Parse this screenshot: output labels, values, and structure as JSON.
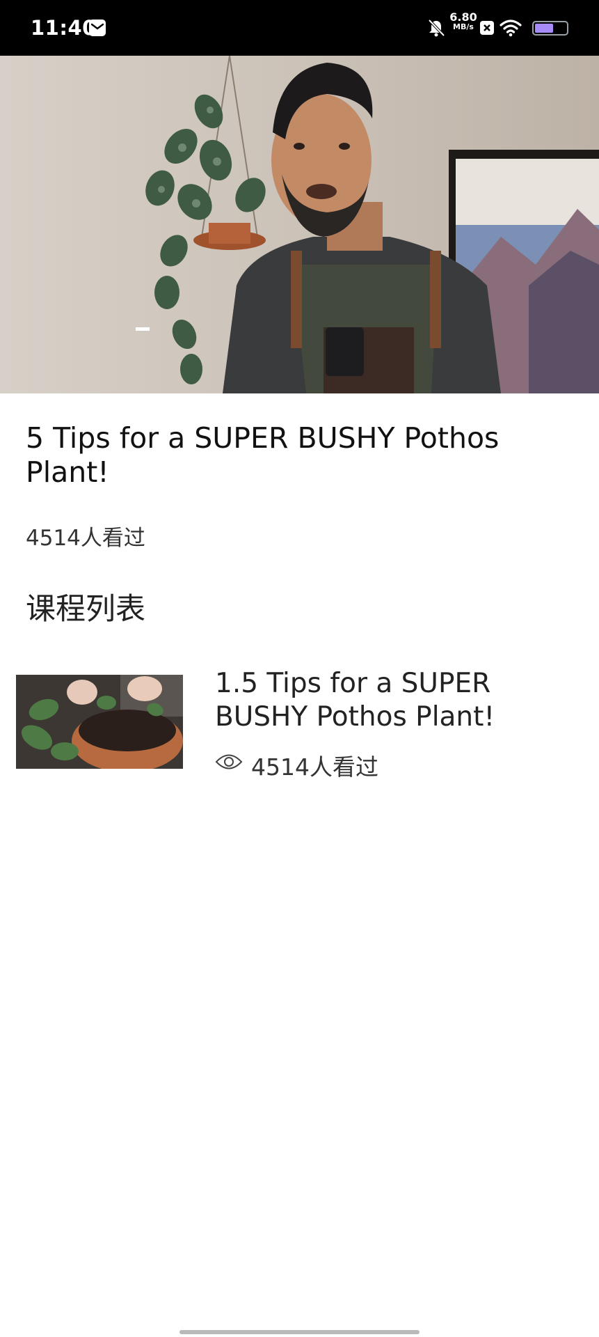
{
  "status_bar": {
    "time": "11:40",
    "net_speed_value": "6.80",
    "net_speed_unit": "MB/s",
    "battery_level": 0.63,
    "icons": [
      "mail-icon",
      "bell-mute-icon",
      "x-badge-icon",
      "wifi-icon",
      "battery-icon"
    ]
  },
  "video": {
    "title": "5 Tips for a SUPER BUSHY Pothos Plant!",
    "view_count": "4514人看过"
  },
  "course_list": {
    "heading": "课程列表",
    "items": [
      {
        "title": "1.5 Tips for a SUPER BUSHY Pothos Plant!",
        "views": "4514人看过",
        "icon": "eye-icon"
      }
    ]
  }
}
